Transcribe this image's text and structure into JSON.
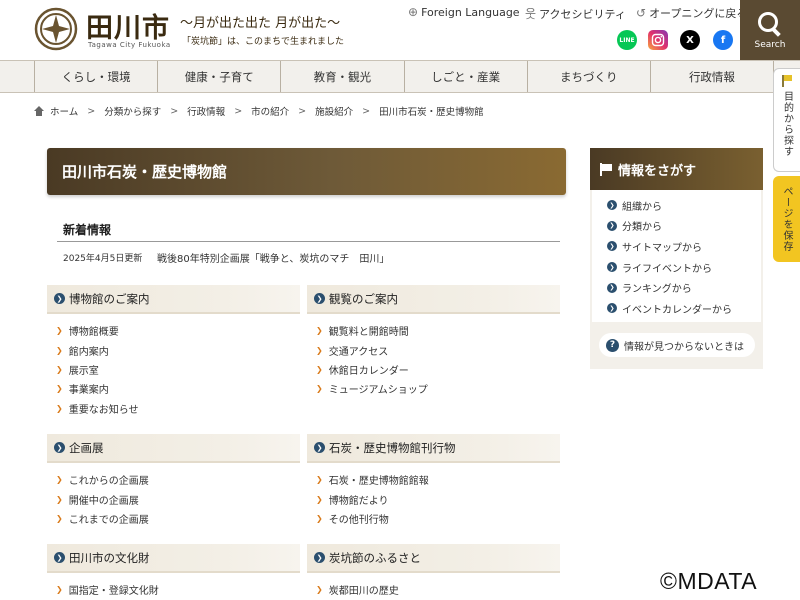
{
  "header": {
    "logo_title": "田川市",
    "logo_sub": "Tagawa City Fukuoka",
    "tagline1": "〜月が出た出た 月が出た〜",
    "tagline2": "「炭坑節」は、このまちで生まれました",
    "util_foreign": "Foreign Language",
    "util_access": "アクセシビリティ",
    "util_opening": "オープニングに戻る",
    "social": {
      "line": "LINE",
      "x": "X",
      "facebook": "f"
    },
    "search_label": "Search"
  },
  "nav": {
    "items": [
      "くらし・環境",
      "健康・子育て",
      "教育・観光",
      "しごと・産業",
      "まちづくり",
      "行政情報"
    ]
  },
  "side_tabs": {
    "purpose": "目的から探す",
    "save": "ページを保存"
  },
  "breadcrumb": {
    "items": [
      "ホーム",
      "分類から探す",
      "行政情報",
      "市の紹介",
      "施設紹介",
      "田川市石炭・歴史博物館"
    ]
  },
  "page_title": "田川市石炭・歴史博物館",
  "news": {
    "heading": "新着情報",
    "date": "2025年4月5日更新",
    "link": "戦後80年特別企画展「戦争と、炭坑のマチ　田川」"
  },
  "categories": [
    {
      "title": "博物館のご案内",
      "items": [
        "博物館概要",
        "館内案内",
        "展示室",
        "事業案内",
        "重要なお知らせ"
      ]
    },
    {
      "title": "観覧のご案内",
      "items": [
        "観覧料と開館時間",
        "交通アクセス",
        "休館日カレンダー",
        "ミュージアムショップ"
      ]
    },
    {
      "title": "企画展",
      "items": [
        "これからの企画展",
        "開催中の企画展",
        "これまでの企画展"
      ]
    },
    {
      "title": "石炭・歴史博物館刊行物",
      "items": [
        "石炭・歴史博物館館報",
        "博物館だより",
        "その他刊行物"
      ]
    },
    {
      "title": "田川市の文化財",
      "items": [
        "国指定・登録文化財"
      ]
    },
    {
      "title": "炭坑節のふるさと",
      "items": [
        "炭都田川の歴史"
      ]
    }
  ],
  "panel": {
    "title": "情報をさがす",
    "items": [
      "組織から",
      "分類から",
      "サイトマップから",
      "ライフイベントから",
      "ランキングから",
      "イベントカレンダーから"
    ],
    "help": "情報が見つからないときは"
  },
  "watermark": "©MDATA"
}
